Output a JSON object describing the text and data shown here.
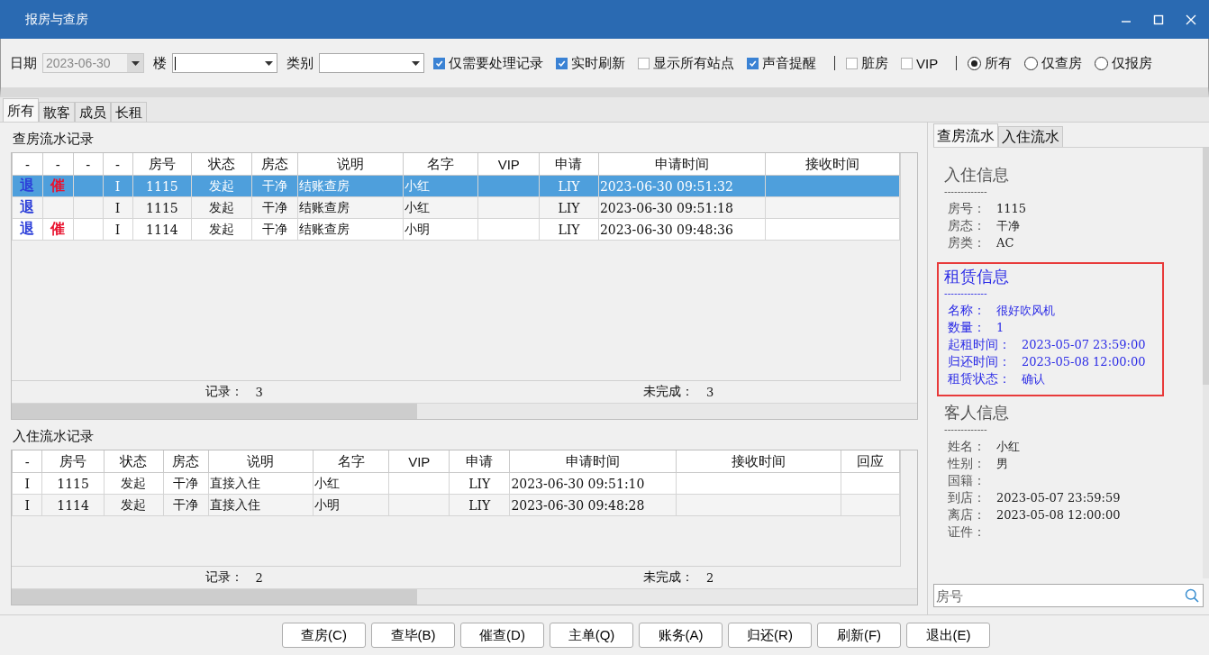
{
  "window": {
    "title": "报房与查房"
  },
  "toolbar": {
    "date_label": "日期",
    "date_value": "2023-06-30",
    "date_disabled": true,
    "building_label": "楼",
    "category_label": "类别",
    "items": [
      {
        "kind": "checkbox",
        "label": "仅需要处理记录",
        "checked": true
      },
      {
        "kind": "checkbox",
        "label": "实时刷新",
        "checked": true
      },
      {
        "kind": "checkbox",
        "label": "显示所有站点",
        "checked": false
      },
      {
        "kind": "checkbox",
        "label": "声音提醒",
        "checked": true
      },
      {
        "kind": "separator"
      },
      {
        "kind": "checkbox",
        "label": "脏房",
        "checked": false
      },
      {
        "kind": "checkbox",
        "label": "VIP",
        "checked": false
      },
      {
        "kind": "separator"
      },
      {
        "kind": "radio",
        "label": "所有",
        "selected": true
      },
      {
        "kind": "radio",
        "label": "仅查房",
        "selected": false
      },
      {
        "kind": "radio",
        "label": "仅报房",
        "selected": false
      }
    ]
  },
  "tabs": [
    {
      "label": "所有",
      "selected": true
    },
    {
      "label": "散客",
      "selected": false
    },
    {
      "label": "成员",
      "selected": false
    },
    {
      "label": "长租",
      "selected": false
    }
  ],
  "checkout_log": {
    "title": "查房流水记录",
    "columns": [
      "-",
      "-",
      "-",
      "-",
      "房号",
      "状态",
      "房态",
      "说明",
      "名字",
      "VIP",
      "申请",
      "申请时间",
      "接收时间"
    ],
    "rows": [
      {
        "selected": true,
        "cells": [
          "退",
          "催",
          "",
          "I",
          "1115",
          "发起",
          "干净",
          "结账查房",
          "小红",
          "",
          "LIY",
          "2023-06-30 09:51:32",
          ""
        ]
      },
      {
        "selected": false,
        "cells": [
          "退",
          "",
          "",
          "I",
          "1115",
          "发起",
          "干净",
          "结账查房",
          "小红",
          "",
          "LIY",
          "2023-06-30 09:51:18",
          ""
        ]
      },
      {
        "selected": false,
        "cells": [
          "退",
          "催",
          "",
          "I",
          "1114",
          "发起",
          "干净",
          "结账查房",
          "小明",
          "",
          "LIY",
          "2023-06-30 09:48:36",
          ""
        ]
      }
    ],
    "footer": {
      "count_label": "记录：",
      "count": "3",
      "pending_label": "未完成：",
      "pending": "3"
    }
  },
  "checkin_log": {
    "title": "入住流水记录",
    "columns": [
      "-",
      "房号",
      "状态",
      "房态",
      "说明",
      "名字",
      "VIP",
      "申请",
      "申请时间",
      "接收时间",
      "回应"
    ],
    "rows": [
      {
        "selected": false,
        "cells": [
          "I",
          "1115",
          "发起",
          "干净",
          "直接入住",
          "小红",
          "",
          "LIY",
          "2023-06-30 09:51:10",
          "",
          ""
        ]
      },
      {
        "selected": false,
        "cells": [
          "I",
          "1114",
          "发起",
          "干净",
          "直接入住",
          "小明",
          "",
          "LIY",
          "2023-06-30 09:48:28",
          "",
          ""
        ]
      }
    ],
    "footer": {
      "count_label": "记录：",
      "count": "2",
      "pending_label": "未完成：",
      "pending": "2"
    }
  },
  "side_panel": {
    "tabs": [
      {
        "label": "查房流水",
        "selected": true
      },
      {
        "label": "入住流水",
        "selected": false
      }
    ],
    "sections": [
      {
        "title": "入住信息",
        "divider": "-------------",
        "highlighted": false,
        "fields": [
          {
            "label": "房号：",
            "value": "1115"
          },
          {
            "label": "房态：",
            "value": "干净"
          },
          {
            "label": "房类：",
            "value": "AC"
          }
        ]
      },
      {
        "title": "租赁信息",
        "divider": "-------------",
        "highlighted": true,
        "fields": [
          {
            "label": "名称：",
            "value": "很好吹风机"
          },
          {
            "label": "数量：",
            "value": "1"
          },
          {
            "label": "起租时间：",
            "value": "2023-05-07 23:59:00"
          },
          {
            "label": "归还时间：",
            "value": "2023-05-08 12:00:00"
          },
          {
            "label": "租赁状态：",
            "value": "确认"
          }
        ]
      },
      {
        "title": "客人信息",
        "divider": "-------------",
        "highlighted": false,
        "fields": [
          {
            "label": "姓名：",
            "value": "小红"
          },
          {
            "label": "性别：",
            "value": "男"
          },
          {
            "label": "国籍："
          },
          {
            "label": "到店：",
            "value": "2023-05-07 23:59:59"
          },
          {
            "label": "离店：",
            "value": "2023-05-08 12:00:00"
          },
          {
            "label": "证件："
          }
        ]
      }
    ],
    "search": {
      "placeholder": "房号"
    }
  },
  "buttons": [
    "查房(C)",
    "查毕(B)",
    "催查(D)",
    "主单(Q)",
    "账务(A)",
    "归还(R)",
    "刷新(F)",
    "退出(E)"
  ]
}
